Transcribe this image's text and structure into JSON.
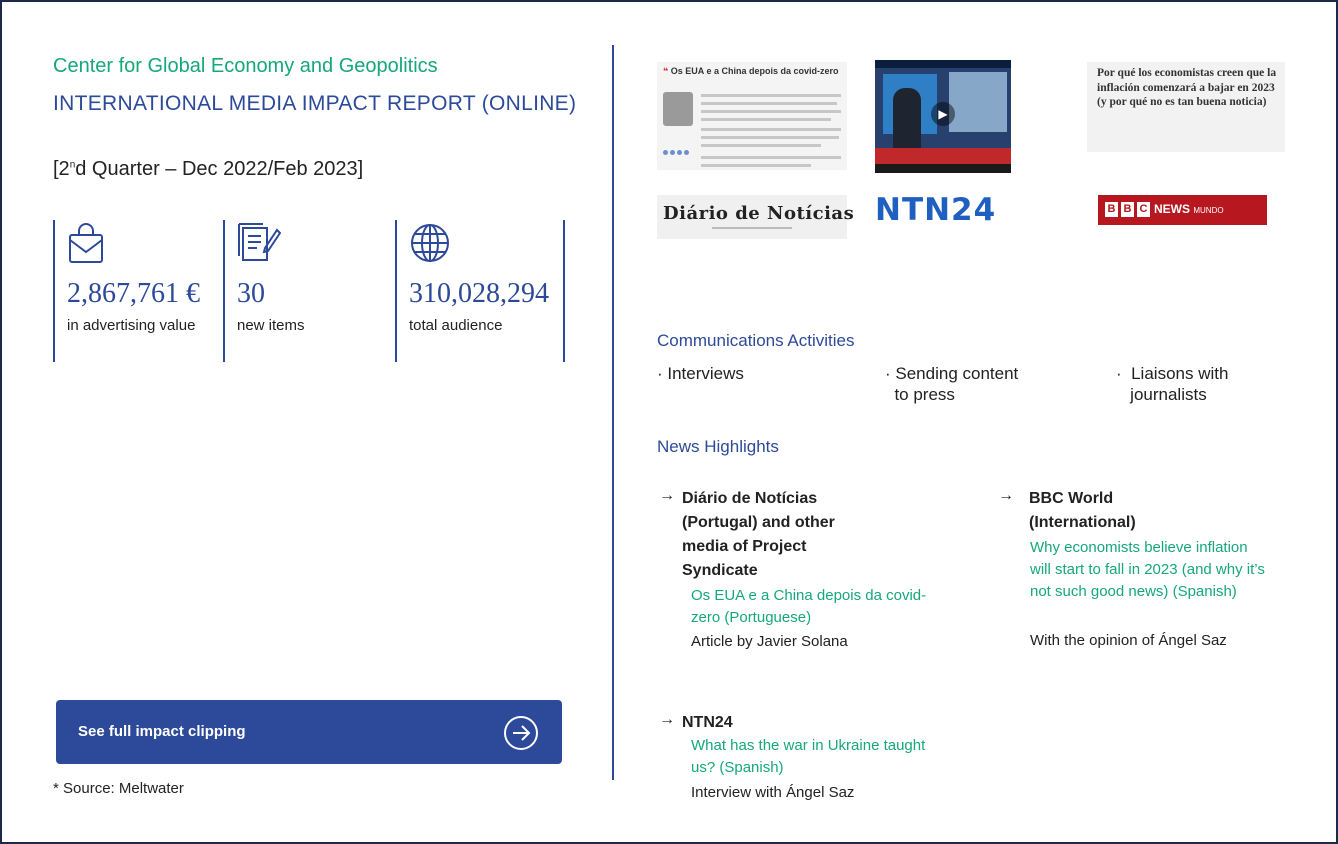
{
  "header": {
    "center_name": "Center for Global Economy and Geopolitics",
    "report_title": "INTERNATIONAL MEDIA IMPACT REPORT (ONLINE)",
    "quarter_prefix": "[2",
    "quarter_sup": "n",
    "quarter_suffix": "d Quarter – Dec 2022/Feb 2023]"
  },
  "stats": [
    {
      "icon": "shopping-bag-icon",
      "value": "2,867,761 €",
      "label": "in advertising value"
    },
    {
      "icon": "document-edit-icon",
      "value": "30",
      "label": "new items"
    },
    {
      "icon": "globe-icon",
      "value": "310,028,294",
      "label": "total audience"
    }
  ],
  "cta": {
    "label": "See full impact clipping",
    "icon": "arrow-circle-icon"
  },
  "source_note": "* Source: Meltwater",
  "thumbnails": {
    "t1_headline": "Os EUA e a China depois da covid-zero",
    "t3_headline": "Por qué los economistas creen que la inflación comenzará a bajar en 2023 (y por qué no es tan buena noticia)",
    "t4_masthead": "Diário de Notícias",
    "t5_logo": "NTN24",
    "t6_news": "NEWS",
    "t6_mundo": "MUNDO",
    "t6_letters": [
      "B",
      "B",
      "C"
    ]
  },
  "communications": {
    "title": "Communications Activities",
    "items": [
      "· Interviews",
      "· Sending content\n  to press",
      "·  Liaisons with\n   journalists"
    ]
  },
  "news": {
    "title": "News Highlights",
    "items": [
      {
        "outlet": "Diário de Notícias (Portugal) and other media of Project Syndicate",
        "headline": "Os EUA e a China depois da covid-zero (Portuguese)",
        "byline": "Article by Javier Solana"
      },
      {
        "outlet": "BBC World (International)",
        "headline": "Why economists believe inflation will start to fall in 2023 (and why it’s not such good news) (Spanish)",
        "byline": "With the opinion of Ángel Saz"
      },
      {
        "outlet": "NTN24",
        "headline": "What has the war in Ukraine taught us? (Spanish)",
        "byline": "Interview with Ángel Saz"
      }
    ],
    "arrow": "→"
  },
  "colors": {
    "accent_green": "#16a77a",
    "accent_blue": "#2d4a9a",
    "bbc_red": "#b7171e"
  }
}
